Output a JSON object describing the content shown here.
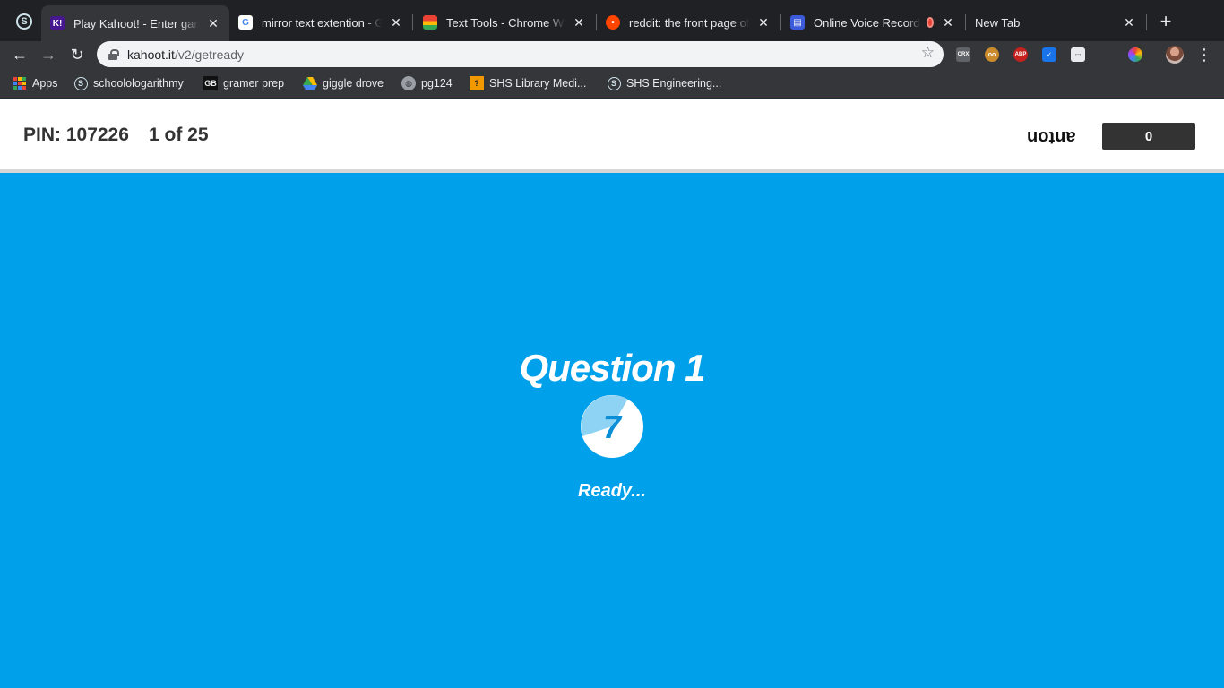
{
  "browser": {
    "tabs": [
      {
        "title": "Play Kahoot! - Enter game",
        "favicon": "kahoot-icon",
        "active": true
      },
      {
        "title": "mirror text extention - Google Search",
        "favicon": "google-icon"
      },
      {
        "title": "Text Tools - Chrome Web Store",
        "favicon": "chrome-web-store-icon"
      },
      {
        "title": "reddit: the front page of the internet",
        "favicon": "reddit-icon"
      },
      {
        "title": "Online Voice Recorder",
        "favicon": "voice-recorder-icon",
        "recording": true
      },
      {
        "title": "New Tab",
        "favicon": ""
      }
    ],
    "address": {
      "host": "kahoot.it",
      "path": "/v2/getready"
    },
    "bookmarks": [
      {
        "label": "Apps",
        "icon": "apps-grid-icon"
      },
      {
        "label": "schoolologarithmy",
        "icon": "schoology-icon"
      },
      {
        "label": "gramer prep",
        "icon": "gb-icon"
      },
      {
        "label": "giggle drove",
        "icon": "google-drive-icon"
      },
      {
        "label": "pg124",
        "icon": "globe-icon"
      },
      {
        "label": "SHS Library Medi...",
        "icon": "library-icon"
      },
      {
        "label": "SHS Engineering...",
        "icon": "schoology-icon"
      }
    ],
    "extensions": [
      "crx-icon",
      "owl-icon",
      "adblock-icon",
      "extension-blue-icon",
      "extension-gray-icon",
      "extension-color-icon"
    ]
  },
  "game": {
    "pin": "PIN: 107226",
    "progress": "1 of 25",
    "nickname": "anton",
    "score": "0",
    "question_label": "Question 1",
    "countdown": "7",
    "status": "Ready..."
  },
  "colors": {
    "background": "#00a0ea",
    "header_bg": "#ffffff",
    "score_bg": "#333333"
  }
}
